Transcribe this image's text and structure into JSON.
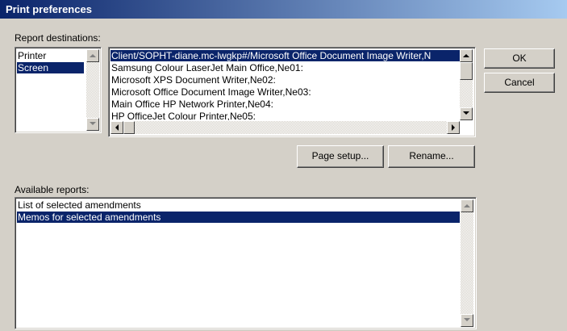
{
  "window": {
    "title": "Print preferences"
  },
  "destinations": {
    "label": "Report destinations:",
    "types": [
      "Printer",
      "Screen"
    ],
    "selected_type_index": 1,
    "printers": [
      "Client/SOPHT-diane.mc-lwgkp#/Microsoft Office Document Image Writer,N",
      "Samsung Colour LaserJet Main Office,Ne01:",
      "Microsoft XPS Document Writer,Ne02:",
      "Microsoft Office Document Image Writer,Ne03:",
      "Main Office HP Network Printer,Ne04:",
      "HP OfficeJet Colour Printer,Ne05:"
    ],
    "selected_printer_index": 0
  },
  "buttons": {
    "ok": "OK",
    "cancel": "Cancel",
    "page_setup": "Page setup...",
    "rename": "Rename..."
  },
  "reports": {
    "label": "Available reports:",
    "items": [
      "List of selected amendments",
      "Memos for selected amendments"
    ],
    "selected_index": 1
  }
}
